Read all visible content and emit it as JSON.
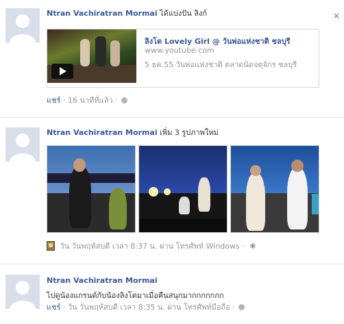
{
  "story1": {
    "author": "Ntran Vachiratran Mormai",
    "action": "ได้แบ่งปัน ลิงก์",
    "close_label": "×",
    "link": {
      "title": "ลิงโต Lovely Girl @ วันพ่อแห่งชาติ ชลบุรี",
      "url": "www.youtube.com",
      "description": "5 ธค.55 วันพ่อแห่งชาติ ตลาดนัดจตุจักร ชลบุรี"
    },
    "share_label": "แชร์",
    "time": "16 นาทีที่แล้ว",
    "separator": "·",
    "privacy_icon": "globe-icon"
  },
  "story2": {
    "author": "Ntran Vachiratran Mormai",
    "action": "เพิ่ม 3 รูปภาพใหม่",
    "photos": [
      "photo-singer-1",
      "photo-singer-2",
      "photo-singer-3"
    ],
    "time": "วัน วันพฤหัสบดี เวลา 8:37 น.",
    "via": "ผ่าน โทรศัพท์ Windows",
    "separator": "·",
    "settings_icon": "gear-icon",
    "source_icon": "phone-app-icon"
  },
  "story3": {
    "author": "Ntran Vachiratran Mormai",
    "text": "ไปดูน้องแกรนด์กับน้องลิงโตมาเมื่อคืนสนุกมากกกกกกก",
    "share_label": "แชร์",
    "time": "วัน วันพฤหัสบดี เวลา 8:35 น.",
    "via": "ผ่าน โทรศัพท์มือถือ",
    "separator": "·",
    "privacy_icon": "globe-icon"
  }
}
